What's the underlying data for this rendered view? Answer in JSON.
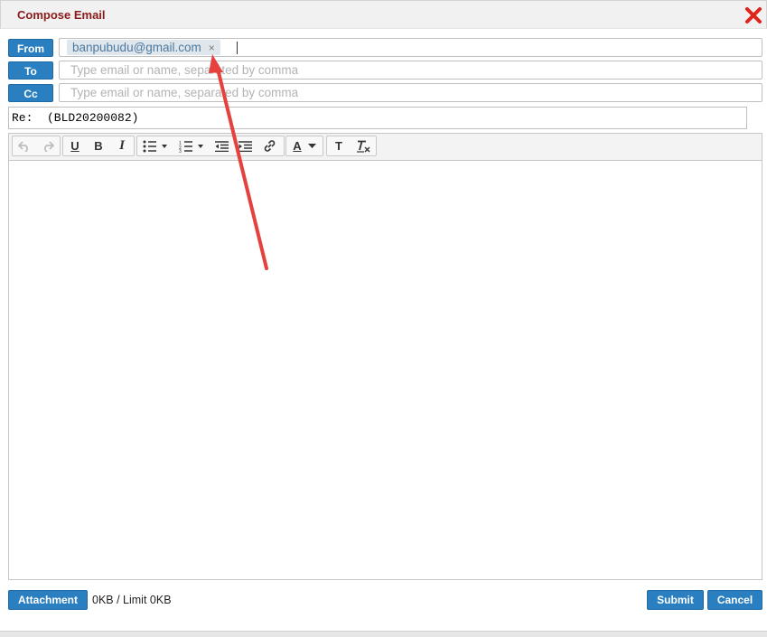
{
  "dialog": {
    "title": "Compose Email"
  },
  "fields": {
    "from_label": "From",
    "from_tag": "banpubudu@gmail.com",
    "to_label": "To",
    "to_placeholder": "Type email or name, separated by comma",
    "cc_label": "Cc",
    "cc_placeholder": "Type email or name, separated by comma",
    "subject": "Re:  (BLD20200082)"
  },
  "toolbar": {
    "underline": "U",
    "bold": "B",
    "italic": "I",
    "font_color": "A",
    "text_style": "T"
  },
  "footer": {
    "attachment_label": "Attachment",
    "limit_text": "0KB / Limit 0KB",
    "submit_label": "Submit",
    "cancel_label": "Cancel"
  },
  "colors": {
    "accent": "#2a7fc0",
    "title": "#8b1a1a",
    "close": "#e0231b",
    "annotation_arrow": "#e5413f"
  }
}
